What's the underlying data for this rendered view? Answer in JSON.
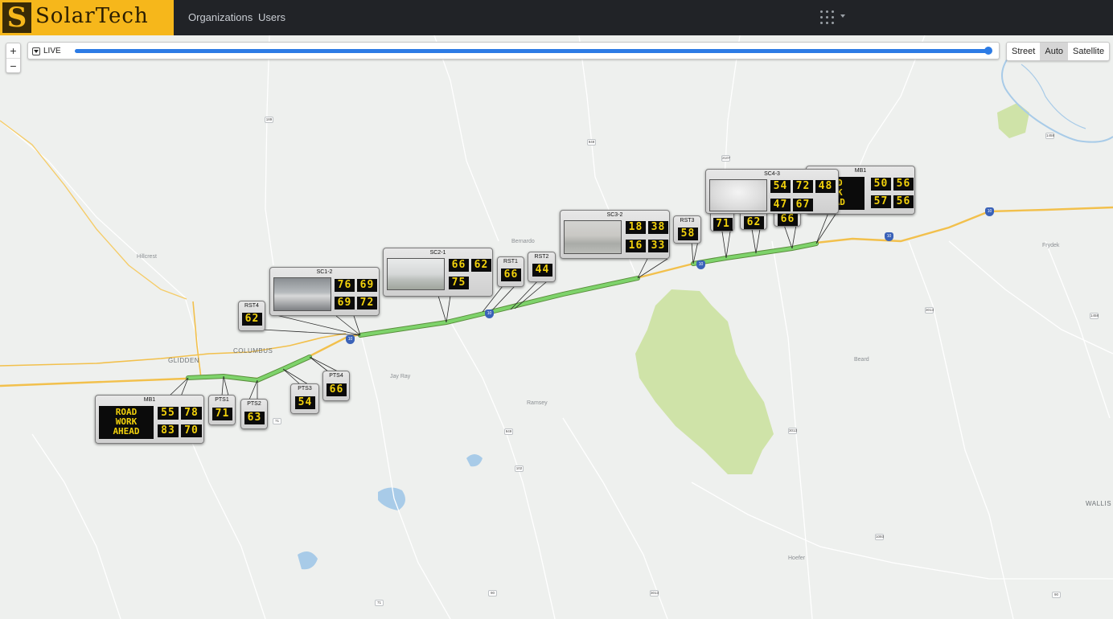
{
  "brand": {
    "logo_text": "SolarTech",
    "logo_letter": "S",
    "colors": {
      "topbar": "#212327",
      "logo_bg": "#f6b71b",
      "route": "#7ed36b",
      "slider": "#2c7be5",
      "readout": "#f2d10c"
    }
  },
  "nav": {
    "organizations": "Organizations",
    "users": "Users",
    "apps_icon": "grid-dots-icon"
  },
  "map_controls": {
    "zoom_in": "+",
    "zoom_out": "−",
    "live_label": "LIVE",
    "time_slider_value": 1.0,
    "layers": [
      {
        "label": "Street"
      },
      {
        "label": "Auto",
        "active": true
      },
      {
        "label": "Satellite"
      }
    ]
  },
  "map_labels": {
    "towns": [
      "GLIDDEN",
      "COLUMBUS"
    ],
    "places": [
      "Hillcrest",
      "Jay Ray",
      "Ramsey",
      "Bernardo",
      "Beard",
      "Frydek",
      "Hoefer",
      "WALLIS"
    ],
    "shields": [
      "189",
      "949",
      "2107",
      "71",
      "949",
      "102",
      "90",
      "71",
      "3013",
      "3013",
      "1093",
      "3013",
      "1458",
      "1458",
      "90"
    ],
    "interstate": [
      "10",
      "10",
      "10",
      "10",
      "10"
    ]
  },
  "devices": [
    {
      "id": "MB1",
      "type": "message",
      "message": "ROAD\nWORK\nAHEAD",
      "readings": [
        "55",
        "78",
        "83",
        "70"
      ]
    },
    {
      "id": "PTS1",
      "type": "speed",
      "readings": [
        "71"
      ]
    },
    {
      "id": "PTS2",
      "type": "speed",
      "readings": [
        "63"
      ]
    },
    {
      "id": "PTS3",
      "type": "speed",
      "readings": [
        "54"
      ]
    },
    {
      "id": "PTS4",
      "type": "speed",
      "readings": [
        "66"
      ]
    },
    {
      "id": "RST4",
      "type": "speed",
      "readings": [
        "62"
      ]
    },
    {
      "id": "SC1-2",
      "type": "camera",
      "readings": [
        "76",
        "69",
        "69",
        "72"
      ]
    },
    {
      "id": "SC2-1",
      "type": "camera",
      "readings": [
        "66",
        "62",
        "75"
      ]
    },
    {
      "id": "RST1",
      "type": "speed",
      "readings": [
        "66"
      ]
    },
    {
      "id": "RST2",
      "type": "speed",
      "readings": [
        "44"
      ]
    },
    {
      "id": "SC3-2",
      "type": "camera",
      "readings": [
        "18",
        "38",
        "16",
        "33"
      ]
    },
    {
      "id": "RST3",
      "type": "speed",
      "readings": [
        "58"
      ]
    },
    {
      "id": "PART1",
      "type": "speed",
      "readings": [
        "71"
      ]
    },
    {
      "id": "PART2",
      "type": "speed",
      "readings": [
        "62"
      ]
    },
    {
      "id": "PART3",
      "type": "speed",
      "readings": [
        "66"
      ]
    },
    {
      "id": "SC4-3",
      "type": "camera",
      "readings": [
        "54",
        "72",
        "48",
        "47",
        "67"
      ]
    },
    {
      "id": "MB1",
      "type": "message",
      "message": "AD\nRK\nEAD",
      "readings": [
        "50",
        "56",
        "57",
        "56"
      ]
    }
  ]
}
